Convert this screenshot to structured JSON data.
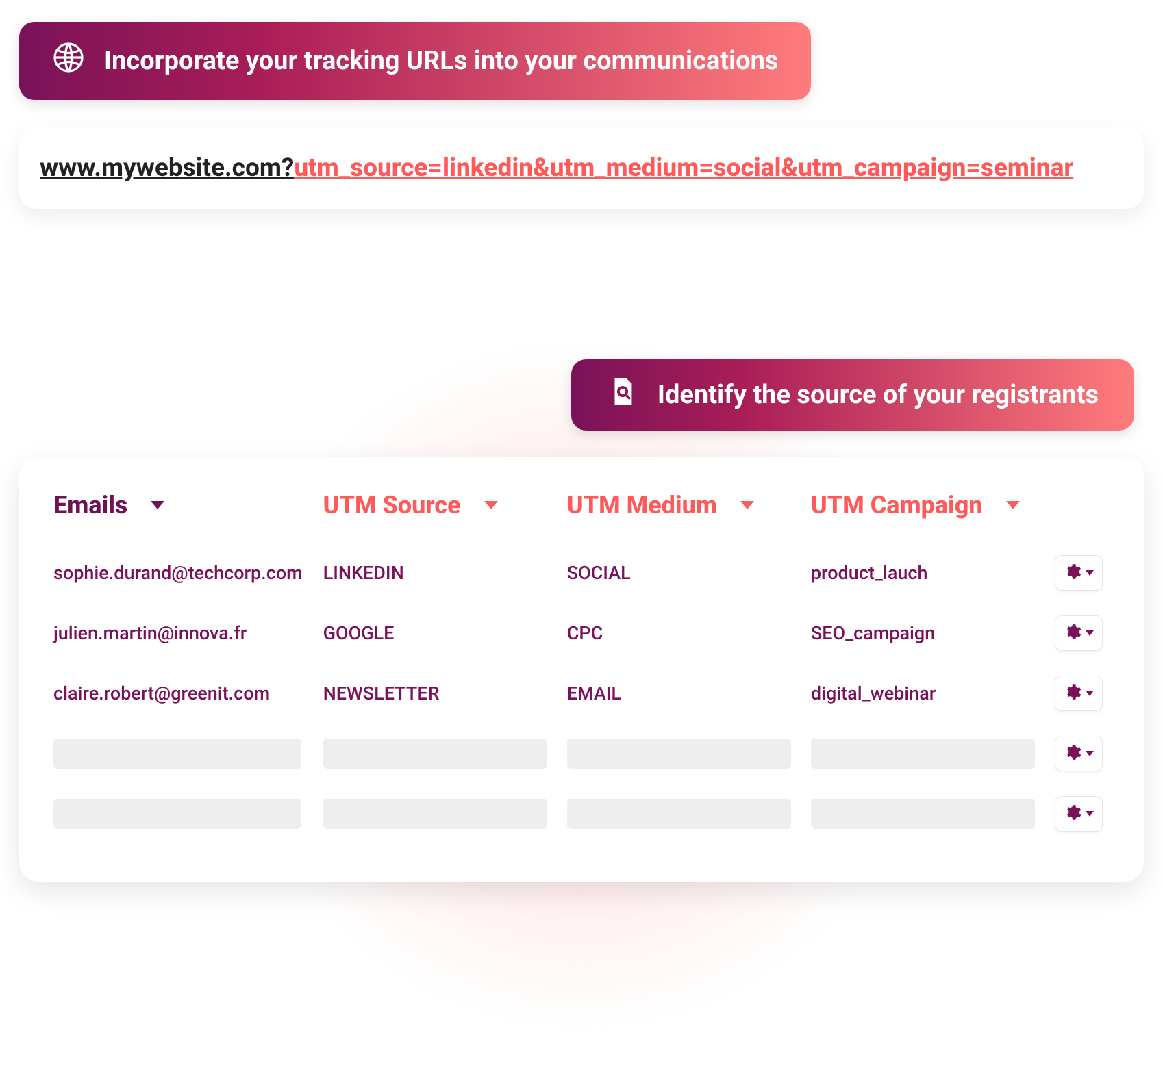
{
  "banners": {
    "top": "Incorporate your tracking URLs into your communications",
    "middle": "Identify the source of your registrants"
  },
  "url_example": {
    "base": "www.mywebsite.com?",
    "utm": "utm_source=linkedin&utm_medium=social&utm_campaign=seminar"
  },
  "table": {
    "headers": {
      "emails": "Emails",
      "source": "UTM Source",
      "medium": "UTM Medium",
      "campaign": "UTM Campaign"
    },
    "rows": [
      {
        "email": "sophie.durand@techcorp.com",
        "source": "LINKEDIN",
        "medium": "SOCIAL",
        "campaign": "product_lauch"
      },
      {
        "email": "julien.martin@innova.fr",
        "source": "GOOGLE",
        "medium": "CPC",
        "campaign": "SEO_campaign"
      },
      {
        "email": "claire.robert@greenit.com",
        "source": "NEWSLETTER",
        "medium": "EMAIL",
        "campaign": "digital_webinar"
      }
    ],
    "empty_rows": 2
  },
  "colors": {
    "brand_purple": "#7a1259",
    "brand_coral": "#ff5a5a"
  }
}
